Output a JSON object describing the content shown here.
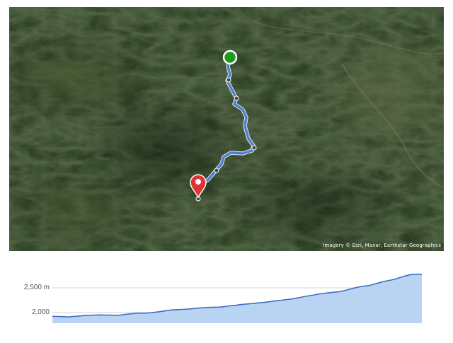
{
  "map": {
    "type": "satellite-terrain",
    "attribution": "Imagery © Esri, Maxar, Earthstar Geographics",
    "colors": {
      "route": "#4a7fd4",
      "start": "#1e9a1e",
      "end": "#dd3333"
    },
    "start_icon": "start-green-dot-icon",
    "end_icon": "end-red-pin-icon"
  },
  "elevation": {
    "unit": "m",
    "ticks": [
      "2,500 m",
      "2,000"
    ],
    "tick_values": [
      2500,
      2000
    ],
    "fill_color": "#b9d3f3",
    "line_color": "#3d6fc2",
    "profile_m": [
      1925,
      1922,
      1918,
      1912,
      1922,
      1930,
      1940,
      1945,
      1950,
      1953,
      1950,
      1948,
      1945,
      1950,
      1965,
      1975,
      1985,
      1990,
      1990,
      2000,
      2010,
      2025,
      2040,
      2055,
      2060,
      2065,
      2070,
      2080,
      2092,
      2100,
      2105,
      2108,
      2110,
      2120,
      2135,
      2145,
      2160,
      2170,
      2180,
      2190,
      2200,
      2210,
      2225,
      2240,
      2250,
      2265,
      2275,
      2295,
      2315,
      2335,
      2350,
      2372,
      2385,
      2398,
      2410,
      2420,
      2440,
      2470,
      2495,
      2520,
      2535,
      2550,
      2580,
      2610,
      2635,
      2655,
      2680,
      2715,
      2745,
      2770,
      2775,
      2770
    ]
  }
}
